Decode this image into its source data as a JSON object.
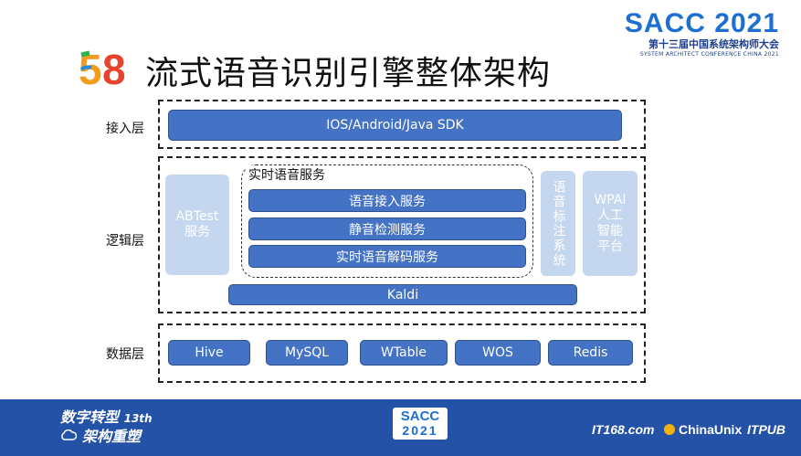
{
  "header": {
    "logo_text": "58",
    "title": "流式语音识别引擎整体架构",
    "conf_logo": "SACC 2021",
    "conf_name_cn": "第十三届中国系统架构师大会",
    "conf_name_en": "SYSTEM ARCHITECT CONFERENCE CHINA 2021"
  },
  "layers": {
    "access": {
      "label": "接入层",
      "bar": "IOS/Android/Java SDK"
    },
    "logic": {
      "label": "逻辑层",
      "abtest": [
        "ABTest",
        "服务"
      ],
      "realtime_group": {
        "label": "实时语音服务",
        "items": [
          "语音接入服务",
          "静音检测服务",
          "实时语音解码服务"
        ]
      },
      "annotation": "语音标注系统",
      "wpai": [
        "WPAI",
        "人工",
        "智能",
        "平台"
      ],
      "kaldi": "Kaldi"
    },
    "data": {
      "label": "数据层",
      "items": [
        "Hive",
        "MySQL",
        "WTable",
        "WOS",
        "Redis"
      ]
    }
  },
  "footer": {
    "slogan_line1": "数字转型",
    "slogan_num": "13th",
    "slogan_line2": "架构重塑",
    "sacc_line1": "SACC",
    "sacc_line2": "2021",
    "logos": [
      "IT168.com",
      "ChinaUnix",
      "ITPUB"
    ]
  },
  "colors": {
    "accent_blue": "#4472c4",
    "pale_blue": "#c5d6ef",
    "footer_blue": "#2452a7"
  }
}
